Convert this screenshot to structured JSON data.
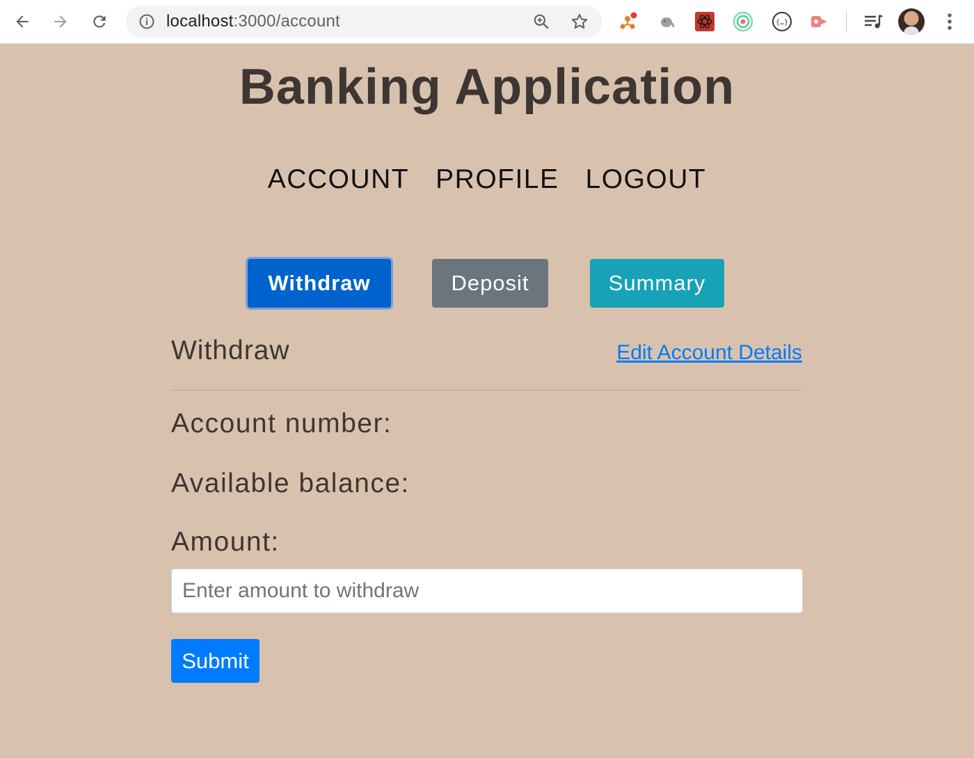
{
  "browser": {
    "url_host": "localhost",
    "url_rest": ":3000/account",
    "icons": {
      "back": "back-arrow-icon",
      "forward": "forward-arrow-icon",
      "reload": "reload-icon",
      "info": "info-icon",
      "zoom": "zoom-icon",
      "bookmark": "bookmark-star-icon",
      "menu": "kebab-menu-icon"
    },
    "extensions": [
      "redux-devtools-icon",
      "elephant-extension-icon",
      "react-devtools-icon",
      "target-extension-icon",
      "json-formatter-icon",
      "record-extension-icon",
      "reading-list-icon"
    ]
  },
  "header": {
    "title": "Banking Application"
  },
  "nav": {
    "items": [
      {
        "label": "ACCOUNT"
      },
      {
        "label": "PROFILE"
      },
      {
        "label": "LOGOUT"
      }
    ]
  },
  "tabs": {
    "withdraw": "Withdraw",
    "deposit": "Deposit",
    "summary": "Summary",
    "active": "Withdraw"
  },
  "form": {
    "section_title": "Withdraw",
    "edit_link": "Edit Account Details",
    "account_number_label": "Account number:",
    "balance_label": "Available balance:",
    "amount_label": "Amount:",
    "amount_placeholder": "Enter amount to withdraw",
    "submit_label": "Submit"
  },
  "colors": {
    "background": "#d9c2ad",
    "primary": "#007bff",
    "secondary": "#6c757d",
    "info": "#17a2b8",
    "link": "#007bff"
  }
}
